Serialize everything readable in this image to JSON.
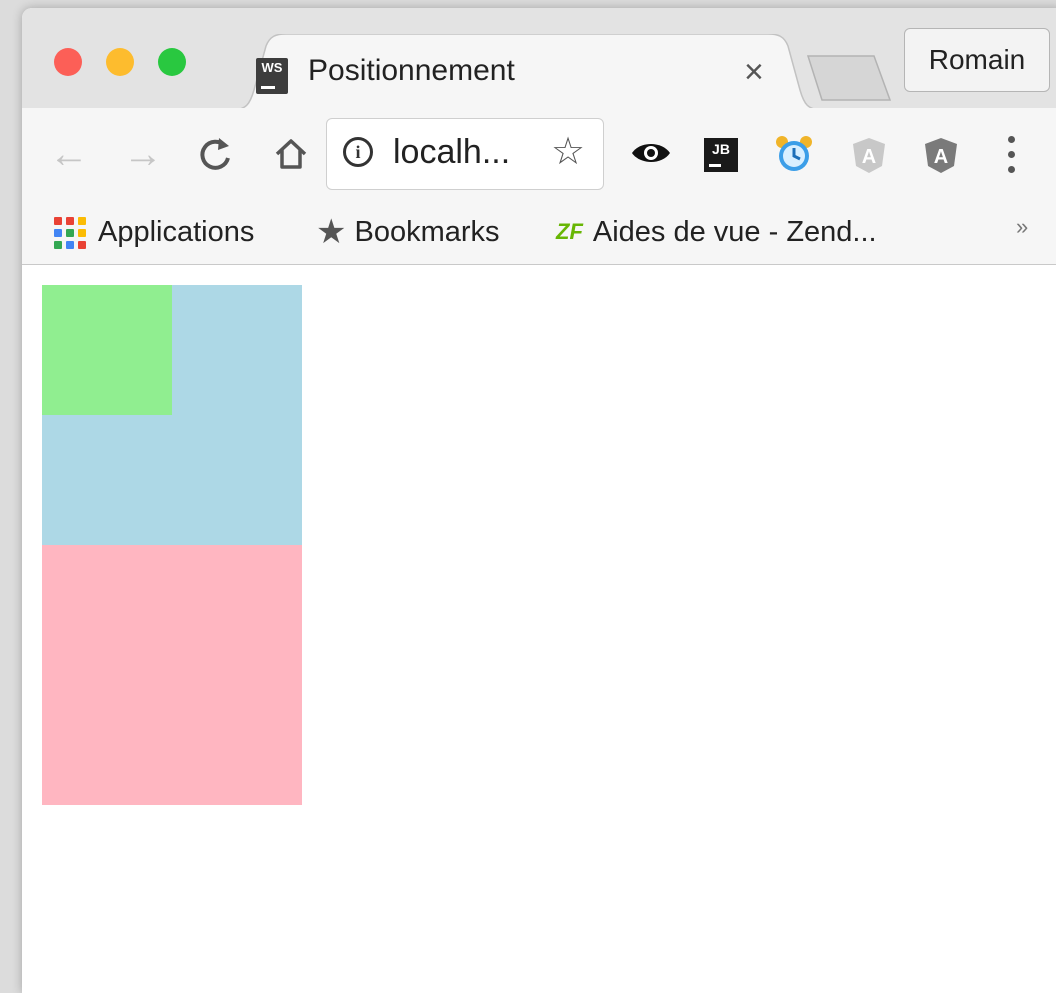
{
  "window": {
    "traffic_lights": {
      "close": "#fc5f57",
      "minimize": "#fdbc2e",
      "zoom": "#29c840"
    }
  },
  "tab": {
    "favicon": "WS",
    "title": "Positionnement",
    "close": "×"
  },
  "profile": {
    "name": "Romain"
  },
  "toolbar": {
    "back_icon": "←",
    "forward_icon": "→",
    "reload_icon": "C",
    "home_icon": "⌂",
    "url": "localh...",
    "info_icon": "i",
    "star_icon": "☆",
    "extensions": [
      {
        "name": "eye-extension"
      },
      {
        "name": "jetbrains-extension",
        "label": "JB"
      },
      {
        "name": "clock-extension"
      },
      {
        "name": "angular-augury-extension",
        "label": "A"
      },
      {
        "name": "angular-extension",
        "label": "A"
      }
    ]
  },
  "bookmarks": {
    "items": [
      {
        "label": "Applications",
        "icon": "apps-grid-icon"
      },
      {
        "label": "Bookmarks",
        "icon": "star-icon"
      },
      {
        "label": "Aides de vue - Zend...",
        "icon": "zend-framework-icon",
        "icon_text": "ZF"
      }
    ],
    "more": "»"
  },
  "page": {
    "boxes": [
      {
        "name": "blue-box",
        "color": "#add8e6"
      },
      {
        "name": "green-box",
        "color": "#90ee90"
      },
      {
        "name": "pink-box",
        "color": "#ffb6c1"
      }
    ]
  }
}
